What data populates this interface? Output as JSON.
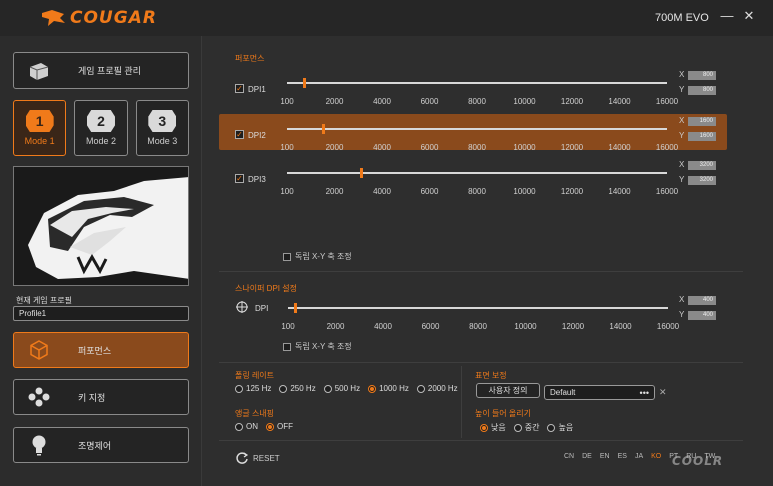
{
  "header": {
    "brand": "COUGAR",
    "model": "700M EVO",
    "minimize": "—",
    "close": "✕"
  },
  "sidebar": {
    "game_profile_button": "게임 프로필 관리",
    "modes": [
      {
        "num": "1",
        "label": "Mode 1",
        "active": true
      },
      {
        "num": "2",
        "label": "Mode 2",
        "active": false
      },
      {
        "num": "3",
        "label": "Mode 3",
        "active": false
      }
    ],
    "current_profile_label": "현재 게임 프로필",
    "current_profile_value": "Profile1",
    "nav": [
      {
        "label": "퍼포먼스",
        "icon": "cube-icon",
        "active": true
      },
      {
        "label": "키 지정",
        "icon": "buttons-icon",
        "active": false
      },
      {
        "label": "조명제어",
        "icon": "lightbulb-icon",
        "active": false
      }
    ]
  },
  "performance": {
    "title": "퍼포먼스",
    "ticks": [
      "100",
      "2000",
      "4000",
      "6000",
      "8000",
      "10000",
      "12000",
      "14000",
      "16000"
    ],
    "rows": [
      {
        "name": "DPI1",
        "x": "800",
        "y": "800",
        "value": 800,
        "checked": true,
        "active": false
      },
      {
        "name": "DPI2",
        "x": "1600",
        "y": "1600",
        "value": 1600,
        "checked": true,
        "active": true
      },
      {
        "name": "DPI3",
        "x": "3200",
        "y": "3200",
        "value": 3200,
        "checked": true,
        "active": false
      }
    ],
    "x_label": "X",
    "y_label": "Y",
    "xy_independent": "독립 X-Y 축 조정",
    "check_mark": "✓"
  },
  "sniper": {
    "title": "스나이퍼 DPI 설정",
    "name": "DPI",
    "x": "400",
    "y": "400",
    "value": 400,
    "ticks": [
      "100",
      "2000",
      "4000",
      "6000",
      "8000",
      "10000",
      "12000",
      "14000",
      "16000"
    ],
    "xy_independent": "독립 X-Y 축 조정"
  },
  "polling": {
    "title": "폴링 레이트",
    "options": [
      "125 Hz",
      "250 Hz",
      "500 Hz",
      "1000 Hz",
      "2000 Hz"
    ],
    "selected": "1000 Hz"
  },
  "angle_snapping": {
    "title": "앵글 스내핑",
    "options": [
      "ON",
      "OFF"
    ],
    "selected": "OFF"
  },
  "surface": {
    "title": "표면 보정",
    "custom_button": "사용자 정의",
    "preset_value": "Default",
    "more": "•••",
    "clear": "✕"
  },
  "lift_off": {
    "title": "높이 들어 올리기",
    "options": [
      "낮음",
      "중간",
      "높음"
    ],
    "selected": "낮음"
  },
  "footer": {
    "reset": "RESET",
    "languages": [
      "CN",
      "DE",
      "EN",
      "ES",
      "JA",
      "KO",
      "PT",
      "RU",
      "TW"
    ],
    "current_language": "KO",
    "watermark": "COOLR"
  },
  "colors": {
    "accent": "#f07a1a",
    "active_row": "#8a4a1c",
    "background": "#2e2e2e"
  }
}
